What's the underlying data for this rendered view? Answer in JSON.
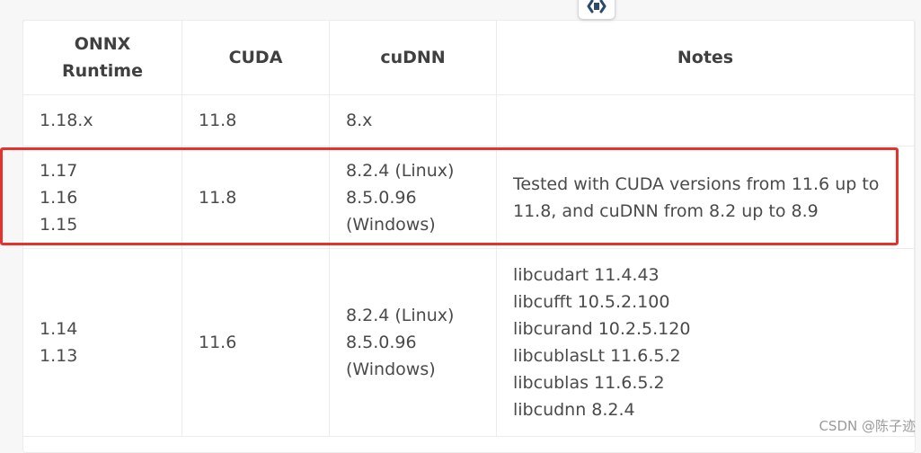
{
  "table": {
    "headers": [
      "ONNX Runtime",
      "CUDA",
      "cuDNN",
      "Notes"
    ],
    "header_onnx_line1": "ONNX",
    "header_onnx_line2": "Runtime",
    "rows": [
      {
        "onnx": [
          "1.18.x"
        ],
        "cuda": "11.8",
        "cudnn": [
          "8.x"
        ],
        "notes": []
      },
      {
        "onnx": [
          "1.17",
          "1.16",
          "1.15"
        ],
        "cuda": "11.8",
        "cudnn": [
          "8.2.4 (Linux)",
          "8.5.0.96",
          "(Windows)"
        ],
        "notes": [
          "Tested with CUDA versions from 11.6 up to",
          "11.8, and cuDNN from 8.2 up to 8.9"
        ]
      },
      {
        "onnx": [
          "1.14",
          "1.13"
        ],
        "cuda": "11.6",
        "cudnn": [
          "8.2.4 (Linux)",
          "8.5.0.96",
          "(Windows)"
        ],
        "notes": [
          "libcudart 11.4.43",
          "libcufft 10.5.2.100",
          "libcurand 10.2.5.120",
          "libcublasLt 11.6.5.2",
          "libcublas 11.6.5.2",
          "libcudnn 8.2.4"
        ]
      }
    ]
  },
  "watermark": "CSDN @陈子迹",
  "colors": {
    "highlight_border": "#e5322d",
    "text": "#404040",
    "grid": "#ececec"
  },
  "floating_button_icon": "code-block-icon"
}
